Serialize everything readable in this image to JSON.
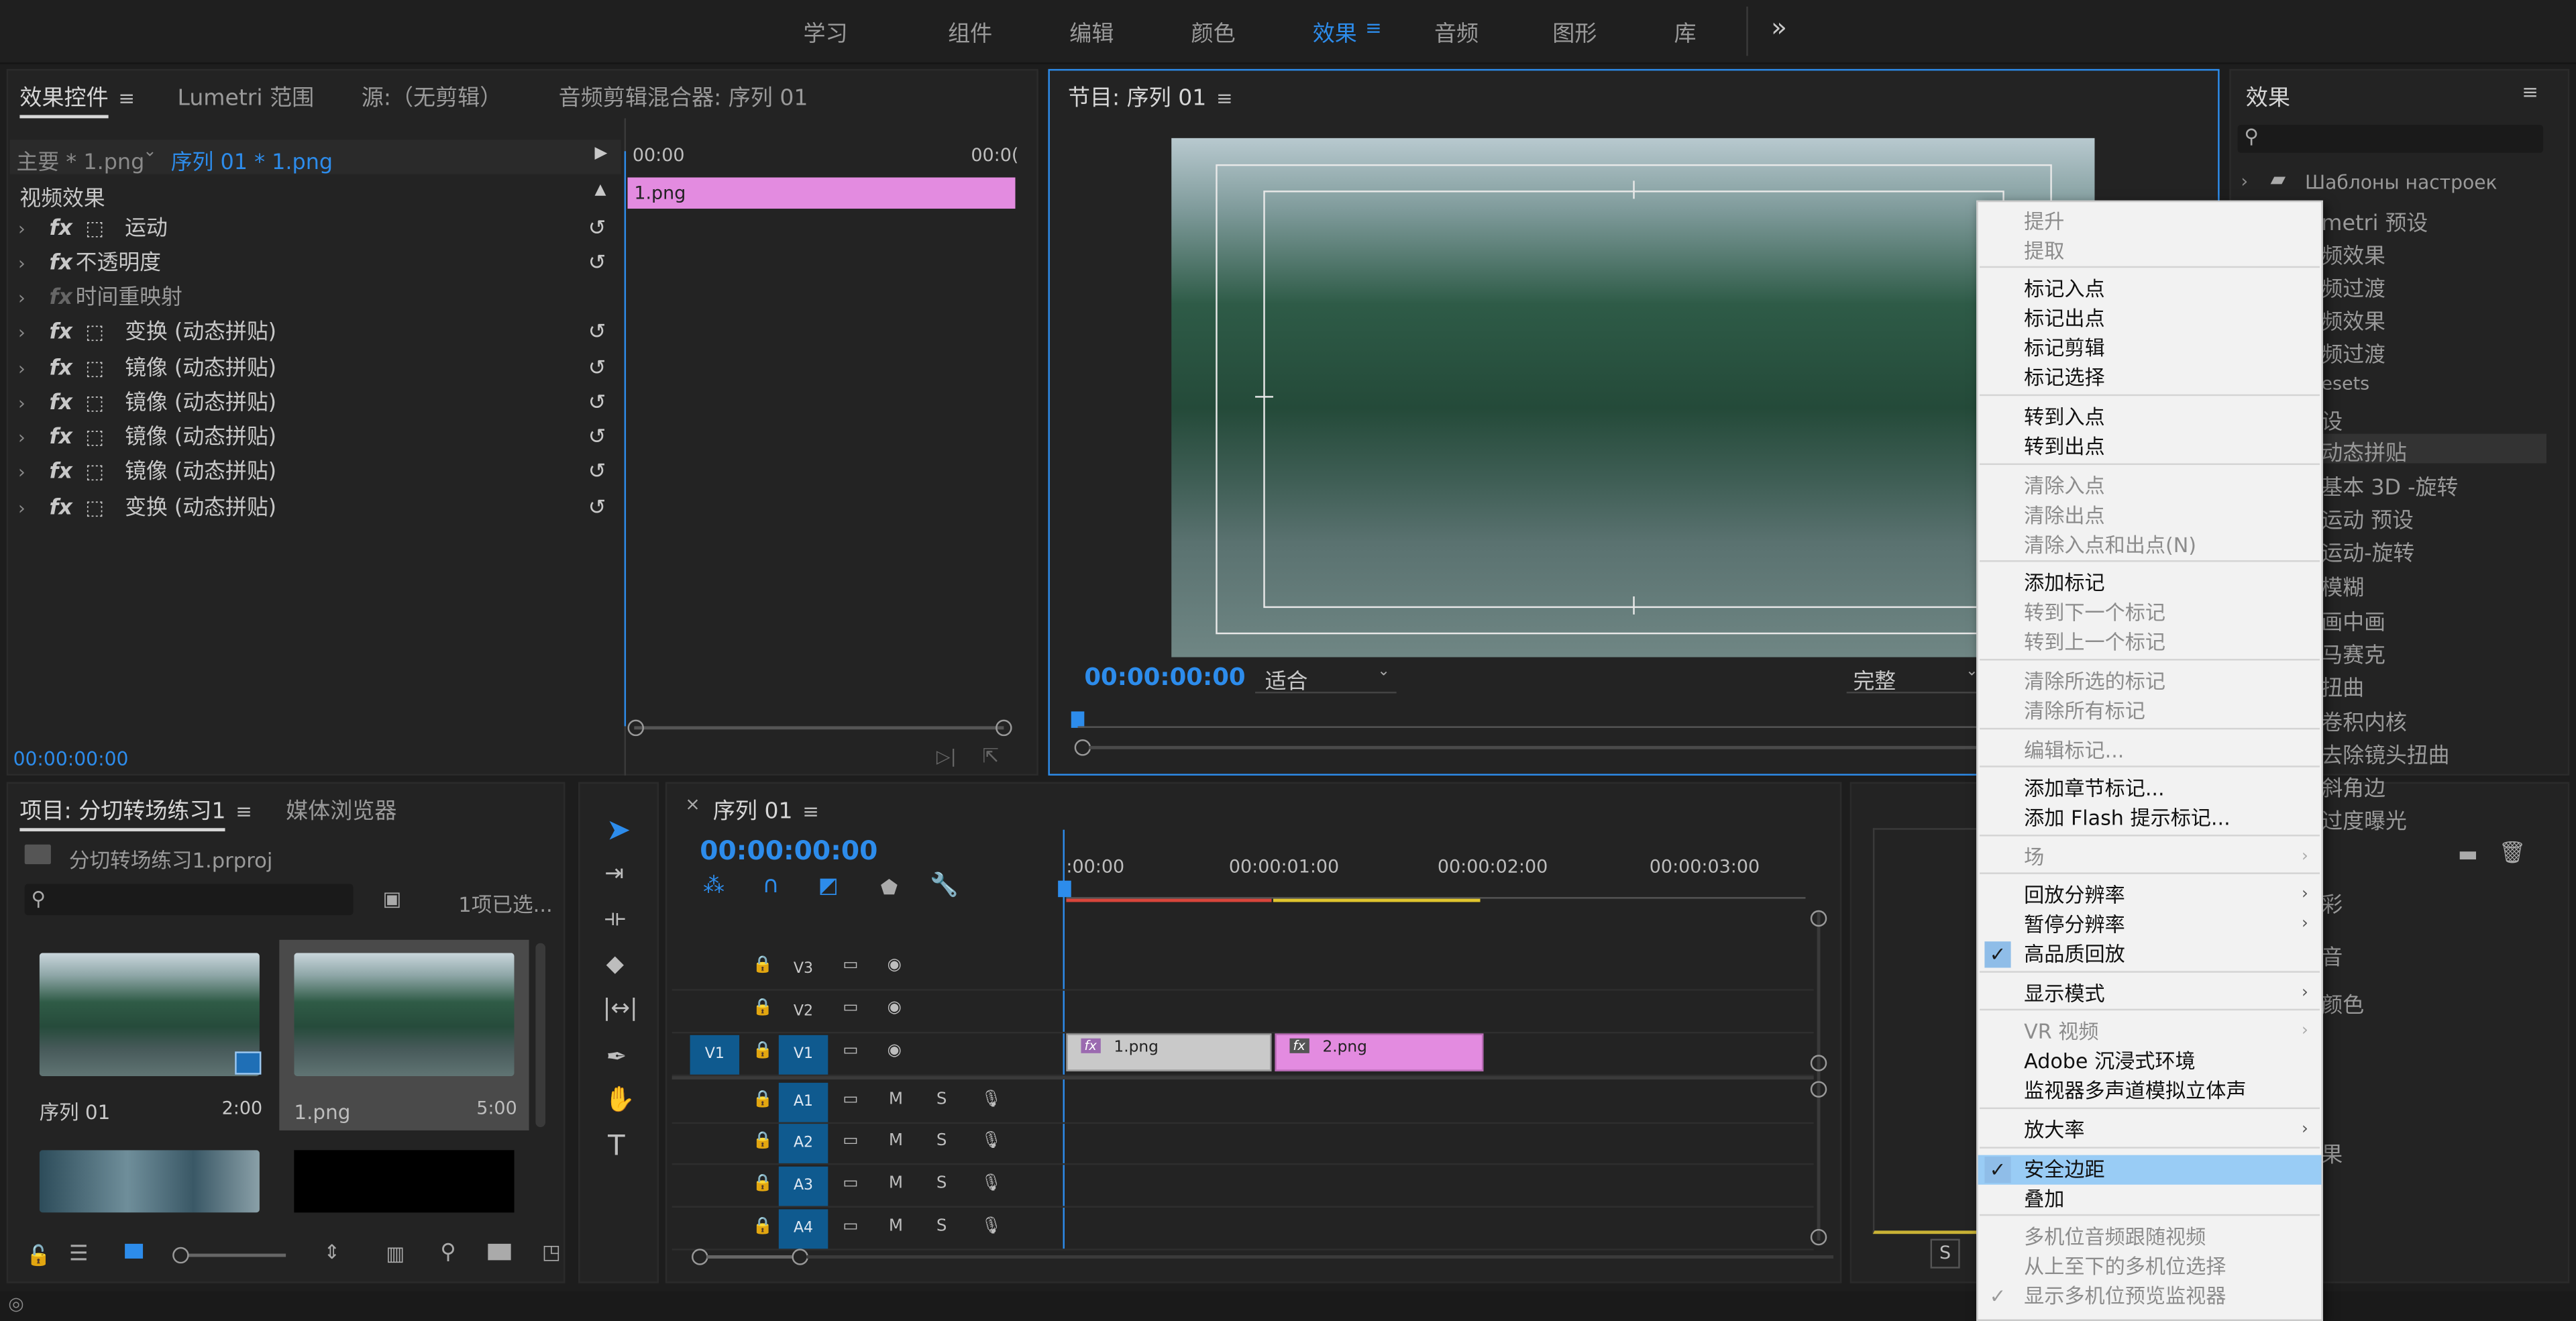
{
  "workspace_tabs": [
    "学习",
    "组件",
    "编辑",
    "颜色",
    "效果",
    "音频",
    "图形",
    "库"
  ],
  "workspace_active": "效果",
  "workspace_overflow": "»",
  "effect_controls": {
    "tabs": [
      "效果控件",
      "Lumetri 范围",
      "源:（无剪辑）",
      "音频剪辑混合器: 序列 01"
    ],
    "master_label": "主要 * 1.png",
    "sequence_label": "序列 01 * 1.png",
    "section": "视频效果",
    "effects": [
      {
        "label": "运动",
        "has_motion": true,
        "dim": false,
        "reset": true
      },
      {
        "label": "不透明度",
        "has_motion": false,
        "dim": false,
        "reset": true
      },
      {
        "label": "时间重映射",
        "has_motion": false,
        "dim": true,
        "reset": false
      },
      {
        "label": "变换 (动态拼贴)",
        "has_motion": true,
        "dim": false,
        "reset": true
      },
      {
        "label": "镜像 (动态拼贴)",
        "has_motion": true,
        "dim": false,
        "reset": true
      },
      {
        "label": "镜像 (动态拼贴)",
        "has_motion": true,
        "dim": false,
        "reset": true
      },
      {
        "label": "镜像 (动态拼贴)",
        "has_motion": true,
        "dim": false,
        "reset": true
      },
      {
        "label": "镜像 (动态拼贴)",
        "has_motion": true,
        "dim": false,
        "reset": true
      },
      {
        "label": "变换 (动态拼贴)",
        "has_motion": true,
        "dim": false,
        "reset": true
      }
    ],
    "time_start": "00:00",
    "time_end": "00:0(",
    "clip_name": "1.png",
    "timecode": "00:00:00:00"
  },
  "program_monitor": {
    "title": "节目: 序列 01",
    "timecode": "00:00:00:00",
    "fit": "适合",
    "quality": "完整"
  },
  "effects_panel": {
    "title": "效果",
    "items": [
      "Шаблоны настроек",
      "metri 预设",
      "频效果",
      "频过渡",
      "频效果",
      "频过渡",
      "esets",
      "设",
      "动态拼贴",
      "基本 3D -旋转",
      "运动 预设",
      "运动-旋转",
      "模糊",
      "画中画",
      "马赛克",
      "扭曲",
      "卷积内核",
      "去除镜头扭曲",
      "斜角边",
      "过度曝光"
    ],
    "selected": "动态拼贴",
    "lower_items": [
      "彩",
      "音",
      "颜色",
      "果"
    ]
  },
  "project_panel": {
    "tabs": [
      "项目: 分切转场练习1",
      "媒体浏览器"
    ],
    "file": "分切转场练习1.prproj",
    "selection_info": "1项已选...",
    "items": [
      {
        "name": "序列 01",
        "duration": "2:00"
      },
      {
        "name": "1.png",
        "duration": "5:00"
      }
    ]
  },
  "timeline": {
    "tab": "序列 01",
    "timecode": "00:00:00:00",
    "ruler": [
      ":00:00",
      "00:00:01:00",
      "00:00:02:00",
      "00:00:03:00"
    ],
    "video_tracks": [
      "V3",
      "V2",
      "V1"
    ],
    "audio_tracks": [
      "A1",
      "A2",
      "A3",
      "A4"
    ],
    "source_patch": "V1",
    "mute_label": "M",
    "solo_label": "S",
    "clips": [
      {
        "name": "1.png",
        "fx": "fx"
      },
      {
        "name": "2.png",
        "fx": "fx"
      }
    ]
  },
  "context_menu": {
    "groups": [
      [
        {
          "label": "提升",
          "enabled": false
        },
        {
          "label": "提取",
          "enabled": false
        }
      ],
      [
        {
          "label": "标记入点",
          "enabled": true
        },
        {
          "label": "标记出点",
          "enabled": true
        },
        {
          "label": "标记剪辑",
          "enabled": true
        },
        {
          "label": "标记选择",
          "enabled": true
        }
      ],
      [
        {
          "label": "转到入点",
          "enabled": true
        },
        {
          "label": "转到出点",
          "enabled": true
        }
      ],
      [
        {
          "label": "清除入点",
          "enabled": false
        },
        {
          "label": "清除出点",
          "enabled": false
        },
        {
          "label": "清除入点和出点(N)",
          "enabled": false
        }
      ],
      [
        {
          "label": "添加标记",
          "enabled": true
        },
        {
          "label": "转到下一个标记",
          "enabled": false
        },
        {
          "label": "转到上一个标记",
          "enabled": false
        }
      ],
      [
        {
          "label": "清除所选的标记",
          "enabled": false
        },
        {
          "label": "清除所有标记",
          "enabled": false
        }
      ],
      [
        {
          "label": "编辑标记...",
          "enabled": false
        }
      ],
      [
        {
          "label": "添加章节标记...",
          "enabled": true
        },
        {
          "label": "添加 Flash 提示标记...",
          "enabled": true
        }
      ],
      [
        {
          "label": "场",
          "enabled": false,
          "submenu": true
        }
      ],
      [
        {
          "label": "回放分辨率",
          "enabled": true,
          "submenu": true
        },
        {
          "label": "暂停分辨率",
          "enabled": true,
          "submenu": true
        },
        {
          "label": "高品质回放",
          "enabled": true,
          "checked": true
        }
      ],
      [
        {
          "label": "显示模式",
          "enabled": true,
          "submenu": true
        }
      ],
      [
        {
          "label": "VR 视频",
          "enabled": false,
          "submenu": true
        },
        {
          "label": "Adobe 沉浸式环境",
          "enabled": true
        },
        {
          "label": "监视器多声道模拟立体声",
          "enabled": true
        }
      ],
      [
        {
          "label": "放大率",
          "enabled": true,
          "submenu": true
        }
      ],
      [
        {
          "label": "安全边距",
          "enabled": true,
          "checked": true,
          "highlight": true
        },
        {
          "label": "叠加",
          "enabled": true
        }
      ],
      [
        {
          "label": "多机位音频跟随视频",
          "enabled": false
        },
        {
          "label": "从上至下的多机位选择",
          "enabled": false
        },
        {
          "label": "显示多机位预览监视器",
          "enabled": false,
          "checked": true
        }
      ]
    ]
  },
  "status_bar_right": "S",
  "colors": {
    "accent": "#2d8ceb",
    "clip_pink": "#e38be0",
    "track_blue": "#0f5a8f",
    "menu_highlight": "#99ccf5"
  }
}
